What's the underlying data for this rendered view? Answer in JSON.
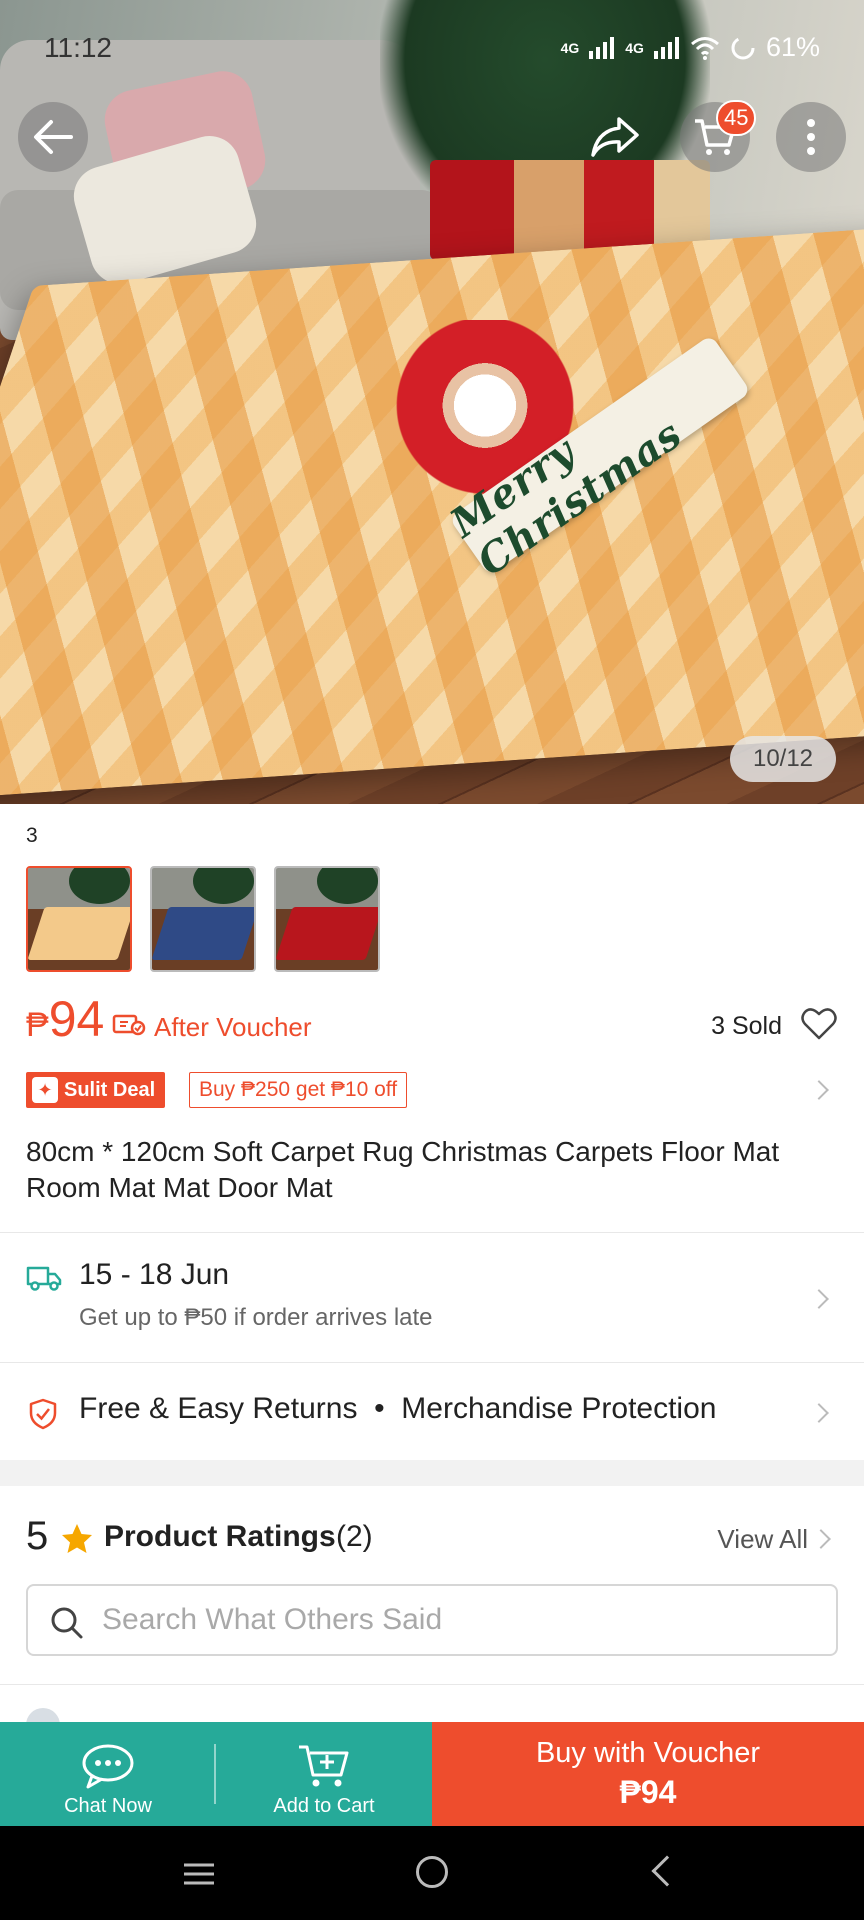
{
  "status_bar": {
    "time": "11:12",
    "network_1": "4G",
    "network_2": "4G",
    "battery": "61%"
  },
  "header": {
    "cart_count": "45"
  },
  "gallery": {
    "image_text": "Merry Christmas",
    "counter": "10/12",
    "variant_count": "3"
  },
  "thumbnails": [
    {
      "rug_color": "#f3c98a",
      "selected": true
    },
    {
      "rug_color": "#2f4a86",
      "selected": false
    },
    {
      "rug_color": "#b8161d",
      "selected": false
    }
  ],
  "price": {
    "currency": "₱",
    "amount": "94",
    "after_voucher": "After Voucher",
    "sold": "3 Sold"
  },
  "deals": {
    "sulit_label": "Sulit Deal",
    "bundle_label": "Buy ₱250 get ₱10 off"
  },
  "product": {
    "title": "80cm * 120cm Soft Carpet Rug Christmas Carpets Floor Mat Room Mat Mat Door Mat"
  },
  "shipping": {
    "date_range": "15 - 18 Jun",
    "guarantee": "Get up to ₱50 if order arrives late"
  },
  "returns": {
    "label_1": "Free & Easy Returns",
    "separator": "•",
    "label_2": "Merchandise Protection"
  },
  "ratings": {
    "score": "5",
    "label": "Product Ratings",
    "count": "(2)",
    "view_all": "View All"
  },
  "search": {
    "placeholder": "Search What Others Said"
  },
  "bottom_bar": {
    "chat_label": "Chat Now",
    "cart_label": "Add to Cart",
    "buy_label": "Buy with Voucher",
    "buy_price": "₱94"
  },
  "colors": {
    "accent": "#ee4d2d",
    "teal": "#26aa99",
    "star": "#f6a700"
  }
}
